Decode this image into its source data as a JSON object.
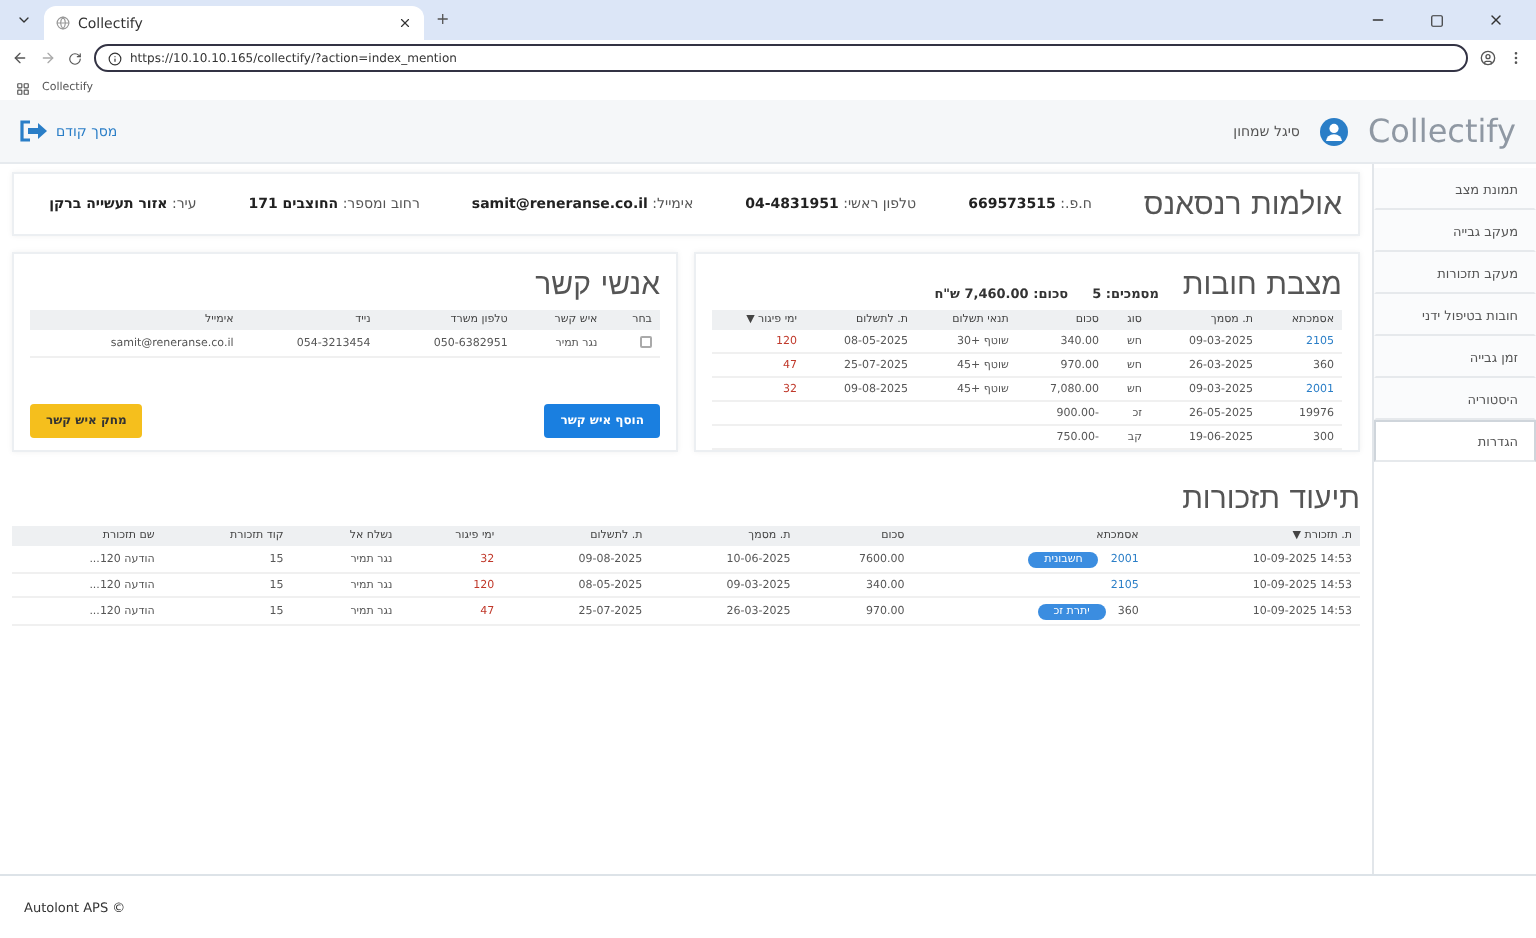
{
  "browser": {
    "tab_title": "Collectify",
    "new_tab": "+",
    "url": "https://10.10.10.165/collectify/?action=index_mention",
    "bookmark": "Collectify"
  },
  "header": {
    "logo": "Collectify",
    "user": "סיגל שמחון",
    "back": "מסך קודם"
  },
  "sidebar": {
    "items": [
      {
        "label": "תמונת מצב",
        "selected": false
      },
      {
        "label": "מעקב גבייה",
        "selected": false
      },
      {
        "label": "מעקב תזכורות",
        "selected": false
      },
      {
        "label": "חובות בטיפול ידני",
        "selected": false
      },
      {
        "label": "זמן גבייה",
        "selected": false
      },
      {
        "label": "היסטוריה",
        "selected": false
      },
      {
        "label": "הגדרות",
        "selected": true
      }
    ]
  },
  "company": {
    "name": "אולמות רנסאנס",
    "fields": [
      {
        "label": "ח.פ.:",
        "value": "669573515"
      },
      {
        "label": "טלפון ראשי:",
        "value": "04-4831951"
      },
      {
        "label": "אימייל:",
        "value": "samit@reneranse.co.il"
      },
      {
        "label": "רחוב ומספר:",
        "value": "החוצבים 171"
      },
      {
        "label": "עיר:",
        "value": "אזור תעשייה ברקן"
      }
    ]
  },
  "debts": {
    "title": "מצבת חובות",
    "summary": [
      {
        "label": "מסמכים:",
        "value": "5"
      },
      {
        "label": "סכום:",
        "value": "7,460.00 ש\"ח"
      }
    ],
    "columns": [
      "אסמכתא",
      "ת. מסמך",
      "סוג",
      "סכום",
      "תנאי תשלום",
      "ת. לתשלום",
      "ימי פיגור ▼"
    ],
    "rows": [
      {
        "linked": true,
        "cells": [
          "2105",
          "09-03-2025",
          "חש",
          "340.00",
          "שוטף +30",
          "08-05-2025",
          "120"
        ]
      },
      {
        "linked": false,
        "cells": [
          "360",
          "26-03-2025",
          "חש",
          "970.00",
          "שוטף +45",
          "25-07-2025",
          "47"
        ]
      },
      {
        "linked": true,
        "cells": [
          "2001",
          "09-03-2025",
          "חש",
          "7,080.00",
          "שוטף +45",
          "09-08-2025",
          "32"
        ]
      },
      {
        "linked": false,
        "cells": [
          "19976",
          "26-05-2025",
          "זכ",
          "-900.00",
          "",
          "",
          ""
        ]
      },
      {
        "linked": false,
        "cells": [
          "300",
          "19-06-2025",
          "קב",
          "-750.00",
          "",
          "",
          ""
        ]
      }
    ]
  },
  "contacts": {
    "title": "אנשי קשר",
    "columns": [
      "בחר",
      "איש קשר",
      "טלפון משרד",
      "נייד",
      "אימייל"
    ],
    "rows": [
      {
        "selected": false,
        "cells": [
          "",
          "נגר תמיר",
          "050-6382951",
          "054-3213454",
          "samit@reneranse.co.il"
        ]
      }
    ],
    "buttons": [
      {
        "label": "הוסף איש קשר",
        "kind": "primary"
      },
      {
        "label": "מחק איש קשר",
        "kind": "warning"
      }
    ]
  },
  "reminders": {
    "title": "תיעוד תזכורות",
    "columns": [
      "ת. תזכורת ▼",
      "אסמכתא",
      "סכום",
      "ת. מסמך",
      "ת. לתשלום",
      "ימי פיגור",
      "נשלח אל",
      "קוד תזכורת",
      "שם תזכורת"
    ],
    "rows": [
      {
        "linked": true,
        "badge": "חשבונית",
        "cells": [
          "14:53 10-09-2025",
          "2001",
          "7600.00",
          "10-06-2025",
          "09-08-2025",
          "32",
          "נגר תמיר",
          "15",
          "הודעה 120..."
        ]
      },
      {
        "linked": true,
        "cells": [
          "14:53 10-09-2025",
          "2105",
          "340.00",
          "09-03-2025",
          "08-05-2025",
          "120",
          "נגר תמיר",
          "15",
          "הודעה 120..."
        ]
      },
      {
        "linked": false,
        "badge": "יתרת זכ",
        "cells": [
          "14:53 10-09-2025",
          "360",
          "970.00",
          "26-03-2025",
          "25-07-2025",
          "47",
          "נגר תמיר",
          "15",
          "הודעה 120..."
        ]
      }
    ]
  },
  "footer": "Autolont APS ©"
}
